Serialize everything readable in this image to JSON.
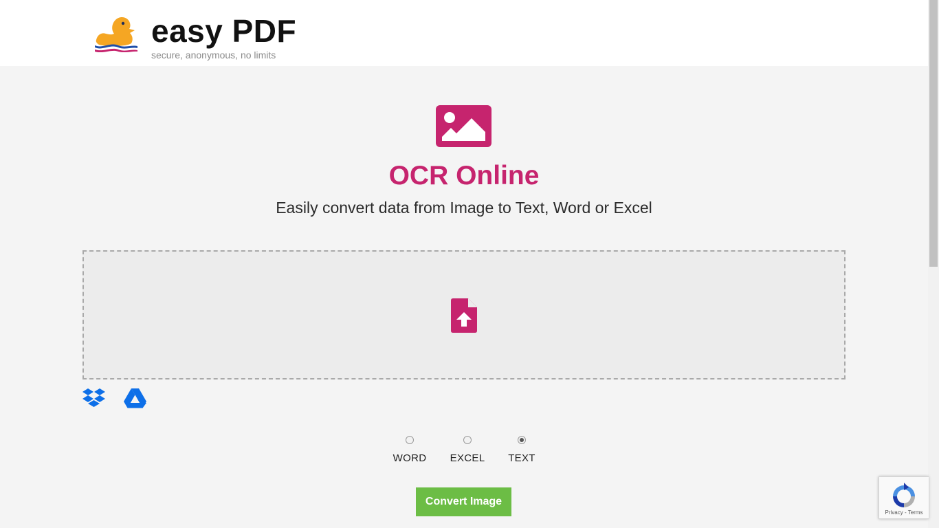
{
  "header": {
    "brand_name": "easy PDF",
    "tagline": "secure, anonymous, no limits",
    "logo_icon": "duck-logo-icon"
  },
  "hero": {
    "icon": "image-icon",
    "title": "OCR Online",
    "subtitle": "Easily convert data from Image to Text, Word or Excel"
  },
  "dropzone": {
    "icon": "file-upload-icon"
  },
  "cloud_sources": [
    {
      "icon": "dropbox-icon"
    },
    {
      "icon": "google-drive-icon"
    }
  ],
  "output_formats": {
    "options": [
      {
        "label": "WORD",
        "checked": false
      },
      {
        "label": "EXCEL",
        "checked": false
      },
      {
        "label": "TEXT",
        "checked": true
      }
    ],
    "selected": "TEXT"
  },
  "convert_button": {
    "label": "Convert Image"
  },
  "recaptcha": {
    "privacy_label": "Privacy",
    "separator": " - ",
    "terms_label": "Terms"
  },
  "colors": {
    "accent": "#c6246e",
    "button": "#6cbd45",
    "background": "#f4f4f4",
    "header_bg": "#ffffff",
    "cloud_icon": "#0d6fe8"
  }
}
